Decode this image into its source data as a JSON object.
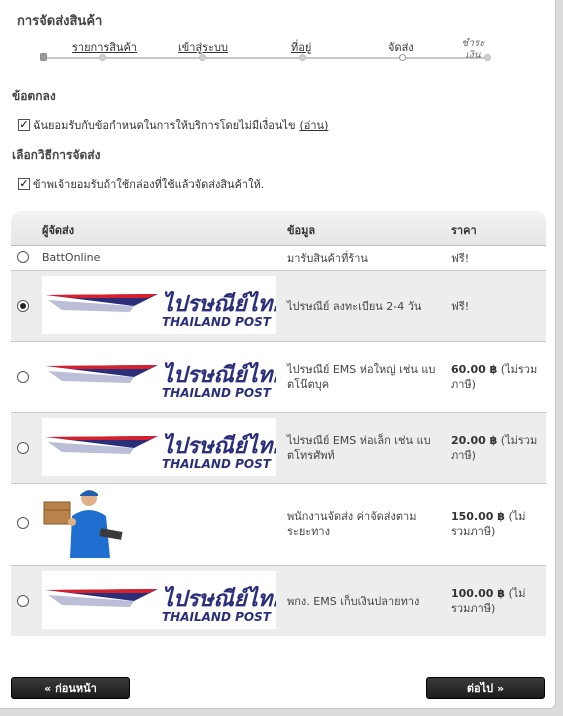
{
  "page_title": "การจัดส่งสินค้า",
  "steps": [
    {
      "label": "รายการสินค้า"
    },
    {
      "label": "เข้าสู่ระบบ"
    },
    {
      "label": "ที่อยู่"
    },
    {
      "label": "จัดส่ง"
    },
    {
      "label": "ชำระ",
      "label2": "เงิน"
    }
  ],
  "terms": {
    "title": "ข้อตกลง",
    "checkbox_label": "ฉันยอมรับกับข้อกำหนดในการให้บริการโดยไม่มีเงื่อนไข",
    "link_label": "(อ่าน)",
    "checked": true
  },
  "shipping_method": {
    "title": "เลือกวิธีการจัดส่ง",
    "checkbox_label": "ข้าพเจ้ายอมรับถ้าใช้กล่องที่ใช้แล้วจัดส่งสินค้าให้.",
    "checked": true
  },
  "table": {
    "headers": {
      "carrier": "ผู้จัดส่ง",
      "info": "ข้อมูล",
      "price": "ราคา"
    },
    "rows": [
      {
        "carrier": "BattOnline",
        "logo": "none",
        "info": "มารับสินค้าที่ร้าน",
        "price": "ฟรี!",
        "price_note": "",
        "selected": false
      },
      {
        "carrier": "Thailand Post",
        "logo": "thailand-post-logo",
        "info": "ไปรษณีย์ ลงทะเบียน 2-4 วัน",
        "price": "ฟรี!",
        "price_note": "",
        "selected": true
      },
      {
        "carrier": "Thailand Post",
        "logo": "thailand-post-logo",
        "info": "ไปรษณีย์ EMS ห่อใหญ่ เช่น แบตโน๊ตบุค",
        "price": "60.00 ฿",
        "price_note": "(ไม่รวมภาษี)",
        "selected": false
      },
      {
        "carrier": "Thailand Post",
        "logo": "thailand-post-logo",
        "info": "ไปรษณีย์ EMS ห่อเล็ก เช่น แบตโทรศัพท์",
        "price": "20.00 ฿",
        "price_note": "(ไม่รวมภาษี)",
        "selected": false
      },
      {
        "carrier": "Courier",
        "logo": "delivery-person-image",
        "info": "พนักงานจัดส่ง ค่าจัดส่งตามระยะทาง",
        "price": "150.00 ฿",
        "price_note": "(ไม่รวมภาษี)",
        "selected": false
      },
      {
        "carrier": "Thailand Post",
        "logo": "thailand-post-logo",
        "info": "พกง. EMS เก็บเงินปลายทาง",
        "price": "100.00 ฿",
        "price_note": "(ไม่รวมภาษี)",
        "selected": false
      }
    ]
  },
  "logo_text": {
    "thai": "ไปรษณีย์ไทย",
    "english": "THAILAND POST"
  },
  "buttons": {
    "back": "« ก่อนหน้า",
    "next": "ต่อไป »"
  },
  "colors": {
    "logo_red": "#d8202a",
    "logo_blue": "#2b2f7a",
    "button_bg": "#2a2a2a"
  }
}
